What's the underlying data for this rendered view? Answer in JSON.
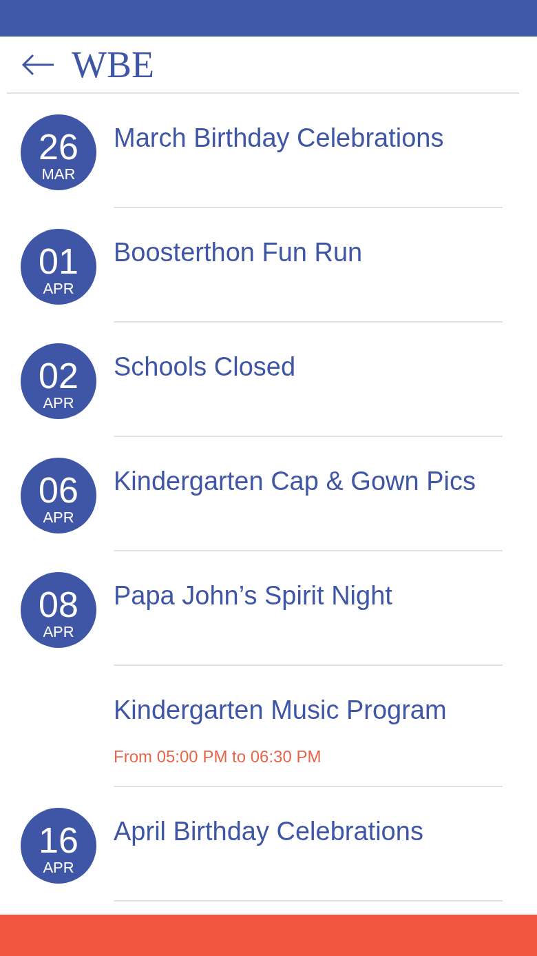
{
  "header": {
    "title": "WBE"
  },
  "events": [
    {
      "day": "26",
      "month": "MAR",
      "title": "March Birthday Celebrations"
    },
    {
      "day": "01",
      "month": "APR",
      "title": "Boosterthon Fun Run"
    },
    {
      "day": "02",
      "month": "APR",
      "title": "Schools Closed"
    },
    {
      "day": "06",
      "month": "APR",
      "title": "Kindergarten Cap & Gown Pics"
    },
    {
      "day": "08",
      "month": "APR",
      "title": "Papa John’s Spirit Night"
    },
    {
      "title": "Kindergarten Music Program",
      "time": "From 05:00 PM to 06:30 PM"
    },
    {
      "day": "16",
      "month": "APR",
      "title": "April Birthday Celebrations"
    }
  ]
}
